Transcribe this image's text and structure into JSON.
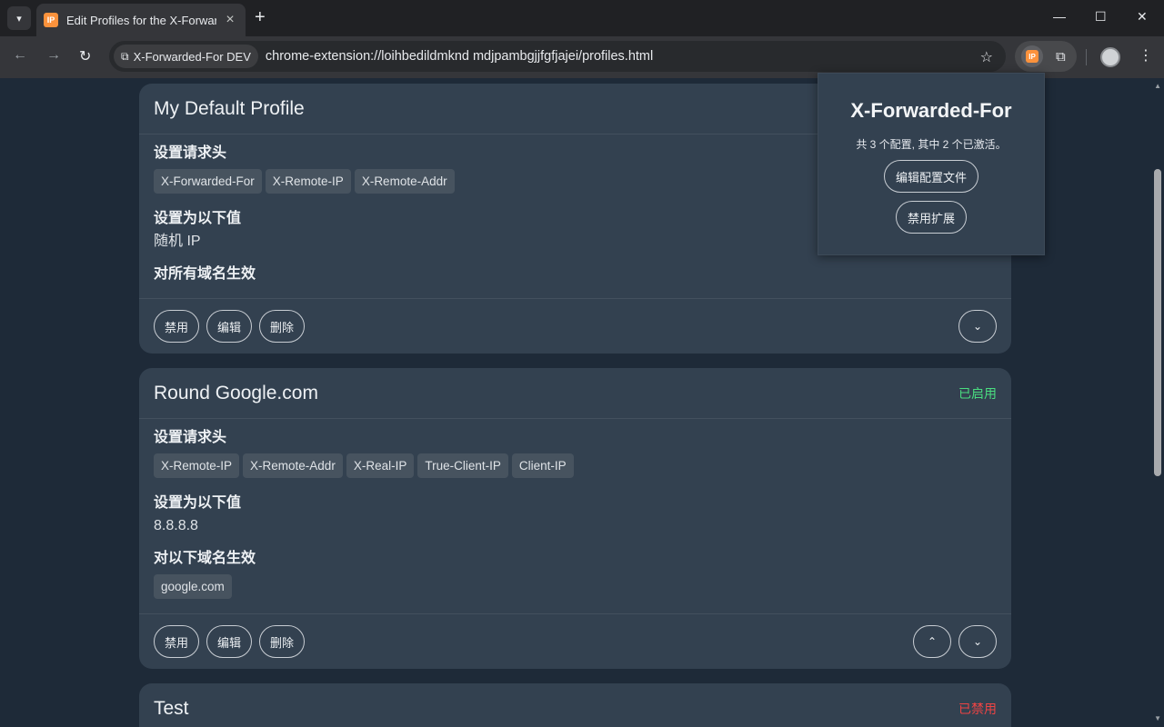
{
  "browser": {
    "tab_title": "Edit Profiles for the X-Forwarded-For",
    "favicon_text": "IP",
    "new_tab_label": "+",
    "site_chip": "X-Forwarded-For DEV",
    "url": "chrome-extension://loihbedildmknd mdjpambgjjfgfjajei/profiles.html",
    "icons": [
      "tab-search-icon",
      "close-icon",
      "plus-icon",
      "minimize-icon",
      "maximize-icon",
      "window-close-icon",
      "back-icon",
      "forward-icon",
      "reload-icon",
      "extension-icon",
      "star-icon",
      "puzzle-icon",
      "kebab-menu-icon"
    ]
  },
  "profiles": [
    {
      "name": "My Default Profile",
      "status": "",
      "headers_title": "设置请求头",
      "headers": [
        "X-Forwarded-For",
        "X-Remote-IP",
        "X-Remote-Addr"
      ],
      "value_title": "设置为以下值",
      "value": "随机 IP",
      "scope_title": "对所有域名生效",
      "domains": [],
      "buttons": {
        "disable": "禁用",
        "edit": "编辑",
        "delete": "删除"
      }
    },
    {
      "name": "Round Google.com",
      "status": "已启用",
      "headers_title": "设置请求头",
      "headers": [
        "X-Remote-IP",
        "X-Remote-Addr",
        "X-Real-IP",
        "True-Client-IP",
        "Client-IP"
      ],
      "value_title": "设置为以下值",
      "value": "8.8.8.8",
      "scope_title": "对以下域名生效",
      "domains": [
        "google.com"
      ],
      "buttons": {
        "disable": "禁用",
        "edit": "编辑",
        "delete": "删除"
      }
    },
    {
      "name": "Test",
      "status": "已禁用"
    }
  ],
  "popup": {
    "title": "X-Forwarded-For",
    "summary": "共 3 个配置, 其中 2 个已激活。",
    "edit_button": "编辑配置文件",
    "disable_button": "禁用扩展"
  },
  "colors": {
    "page_bg": "#1e2a38",
    "card_bg": "#334150",
    "enabled": "#4ade80",
    "disabled": "#ef4444",
    "accent": "#fb923c"
  }
}
